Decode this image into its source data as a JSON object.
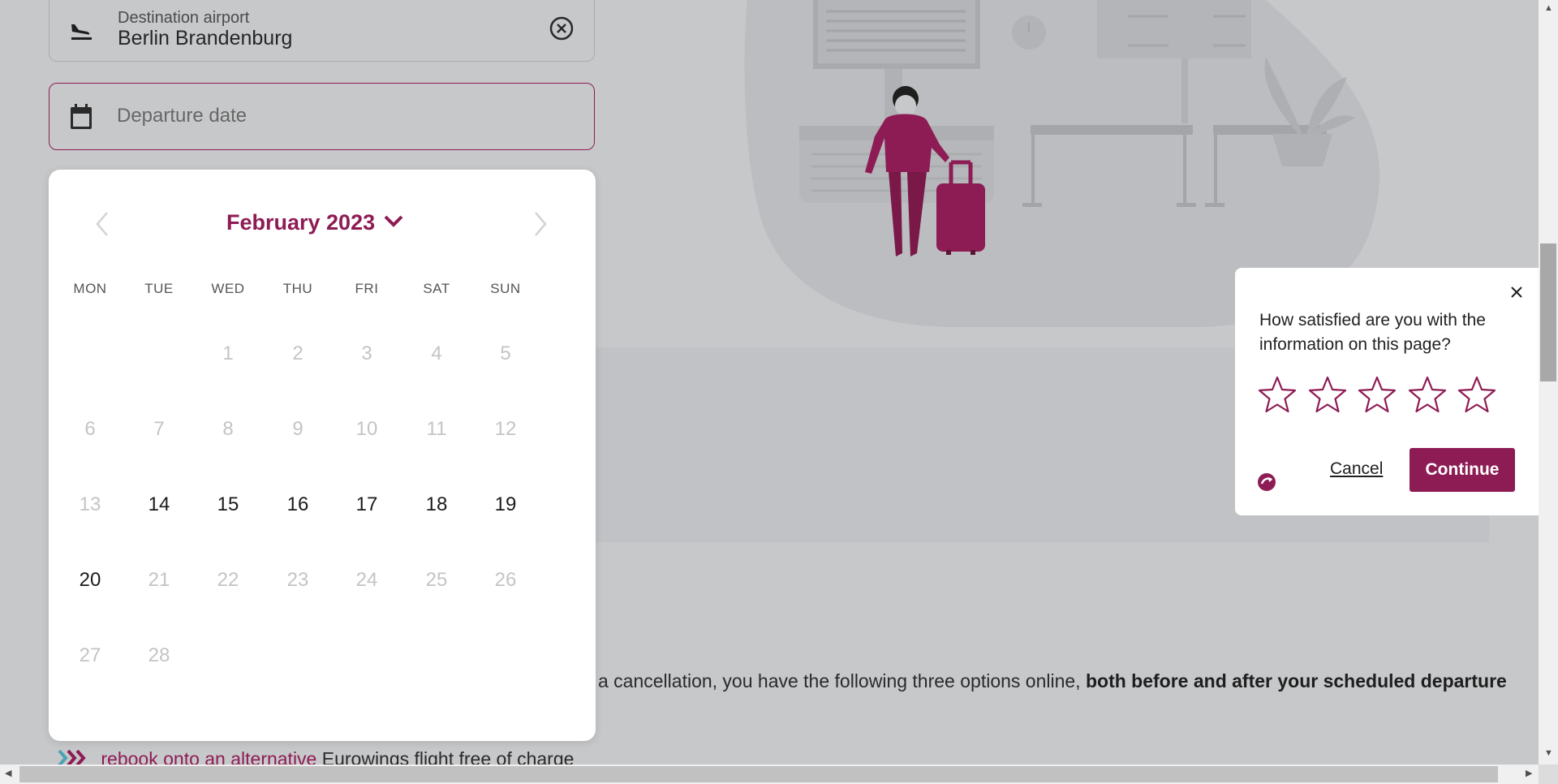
{
  "destination_field": {
    "label": "Destination airport",
    "value": "Berlin Brandenburg",
    "icon": "airplane-landing-icon",
    "clear_icon": "close-circle-icon"
  },
  "departure_field": {
    "placeholder": "Departure date",
    "icon": "calendar-icon"
  },
  "calendar": {
    "month_label": "February 2023",
    "weekdays": [
      "MON",
      "TUE",
      "WED",
      "THU",
      "FRI",
      "SAT",
      "SUN"
    ],
    "days": [
      {
        "day": "1",
        "enabled": false
      },
      {
        "day": "2",
        "enabled": false
      },
      {
        "day": "3",
        "enabled": false
      },
      {
        "day": "4",
        "enabled": false
      },
      {
        "day": "5",
        "enabled": false
      },
      {
        "day": "6",
        "enabled": false
      },
      {
        "day": "7",
        "enabled": false
      },
      {
        "day": "8",
        "enabled": false
      },
      {
        "day": "9",
        "enabled": false
      },
      {
        "day": "10",
        "enabled": false
      },
      {
        "day": "11",
        "enabled": false
      },
      {
        "day": "12",
        "enabled": false
      },
      {
        "day": "13",
        "enabled": false
      },
      {
        "day": "14",
        "enabled": true
      },
      {
        "day": "15",
        "enabled": true
      },
      {
        "day": "16",
        "enabled": true
      },
      {
        "day": "17",
        "enabled": true
      },
      {
        "day": "18",
        "enabled": true
      },
      {
        "day": "19",
        "enabled": true
      },
      {
        "day": "20",
        "enabled": true
      },
      {
        "day": "21",
        "enabled": false
      },
      {
        "day": "22",
        "enabled": false
      },
      {
        "day": "23",
        "enabled": false
      },
      {
        "day": "24",
        "enabled": false
      },
      {
        "day": "25",
        "enabled": false
      },
      {
        "day": "26",
        "enabled": false
      },
      {
        "day": "27",
        "enabled": false
      },
      {
        "day": "28",
        "enabled": false
      }
    ],
    "prev_icon": "chevron-left-icon",
    "next_icon": "chevron-right-icon",
    "toggle_icon": "chevron-down-icon"
  },
  "content": {
    "text_plain": "a cancellation, you have the following three options online,",
    "text_bold": "both before and after your scheduled departure",
    "rebook_link": "rebook onto an alternative",
    "rebook_rest": "Eurowings flight free of charge"
  },
  "survey": {
    "question": "How satisfied are you with the information on this page?",
    "stars": 5,
    "rating": 0,
    "cancel_label": "Cancel",
    "continue_label": "Continue"
  },
  "colors": {
    "brand": "#8d1c54",
    "overlay_bg": "#c7c8ca"
  }
}
